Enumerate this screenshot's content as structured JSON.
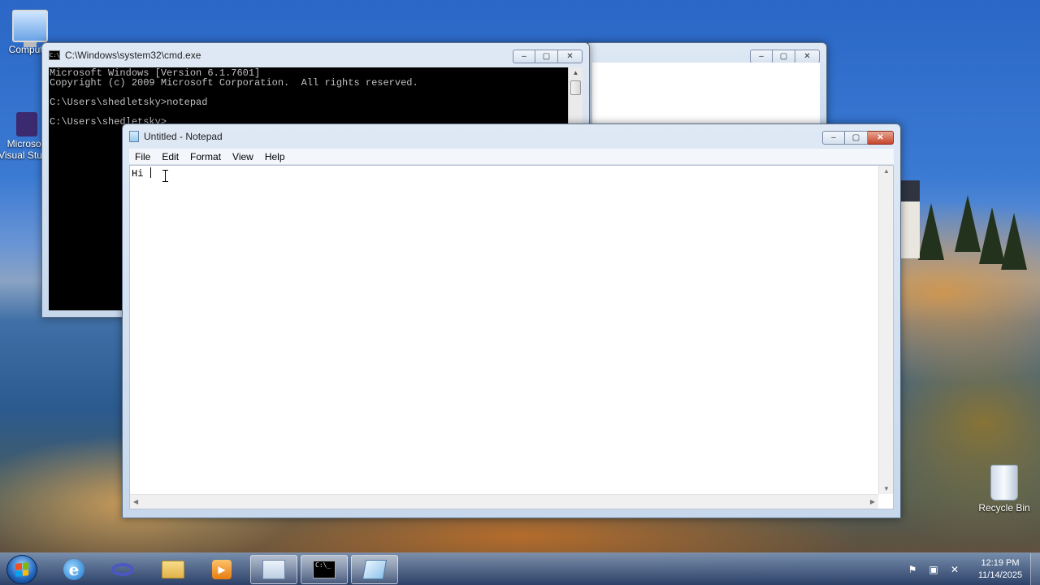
{
  "desktop": {
    "icons": {
      "computer": "Computer",
      "visual_studio_line1": "Microsoft",
      "visual_studio_line2": "Visual Studio",
      "recycle_bin": "Recycle Bin"
    }
  },
  "cmd_window": {
    "title": "C:\\Windows\\system32\\cmd.exe",
    "output": "Microsoft Windows [Version 6.1.7601]\nCopyright (c) 2009 Microsoft Corporation.  All rights reserved.\n\nC:\\Users\\shedletsky>notepad\n\nC:\\Users\\shedletsky>"
  },
  "notepad": {
    "title": "Untitled - Notepad",
    "menu": [
      "File",
      "Edit",
      "Format",
      "View",
      "Help"
    ],
    "content": "Hi "
  },
  "window_buttons": {
    "minimize": "–",
    "maximize": "▢",
    "close": "✕"
  },
  "taskbar": {
    "items": [
      "start-button",
      "internet-explorer",
      "visual-studio",
      "windows-explorer",
      "media-player",
      "explorer-window",
      "command-prompt",
      "notepad"
    ],
    "clock_time": "12:19 PM",
    "clock_date": "11/14/2025"
  }
}
